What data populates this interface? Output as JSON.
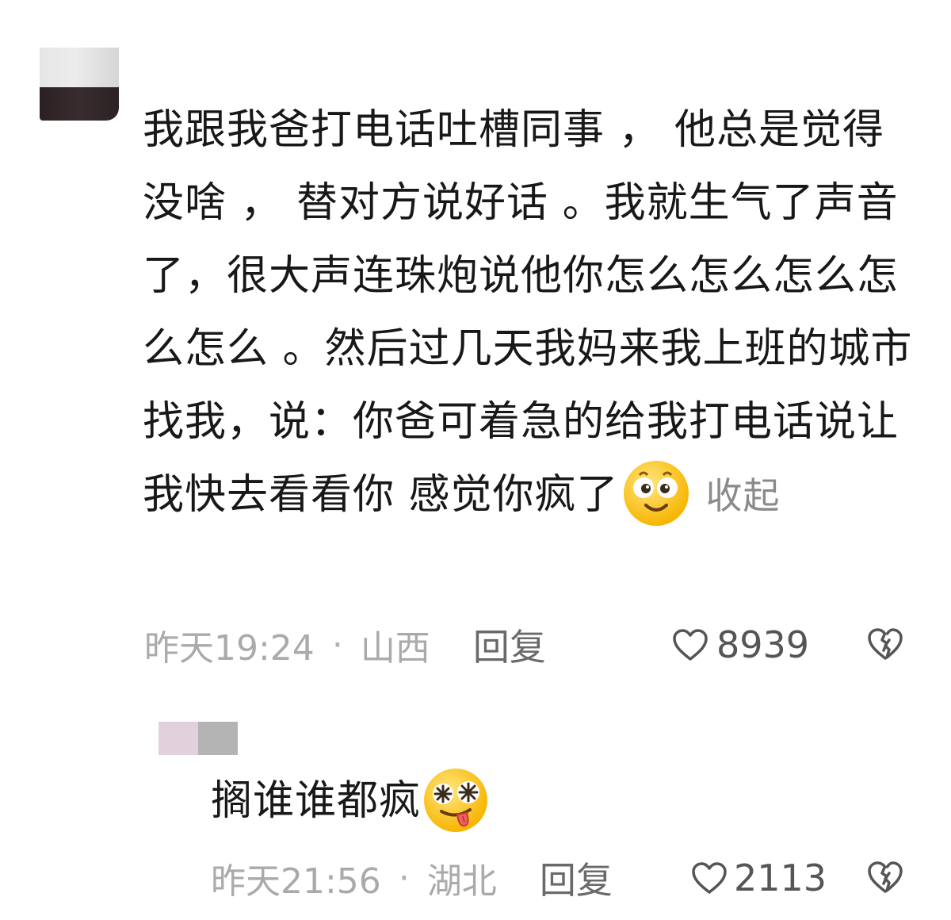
{
  "comment": {
    "text": "我跟我爸打电话吐槽同事 ， 他总是觉得没啥 ， 替对方说好话 。我就生气了声音了，很大声连珠炮说他你怎么怎么怎么怎么怎么 。然后过几天我妈来我上班的城市找我，说：你爸可着急的给我打电话说让我快去看看你 感觉你疯了",
    "emoji": "smile-emoji",
    "collapse_label": "收起",
    "time": "昨天19:24",
    "separator": "·",
    "location": "山西",
    "reply_label": "回复",
    "likes": "8939"
  },
  "reply": {
    "text": "搁谁谁都疯",
    "emoji": "crazy-tongue-emoji",
    "time": "昨天21:56",
    "separator": "·",
    "location": "湖北",
    "reply_label": "回复",
    "likes": "2113"
  },
  "colors": {
    "text": "#181818",
    "meta": "#aaaaaa",
    "emoji_yellow": "#ffd23c"
  }
}
